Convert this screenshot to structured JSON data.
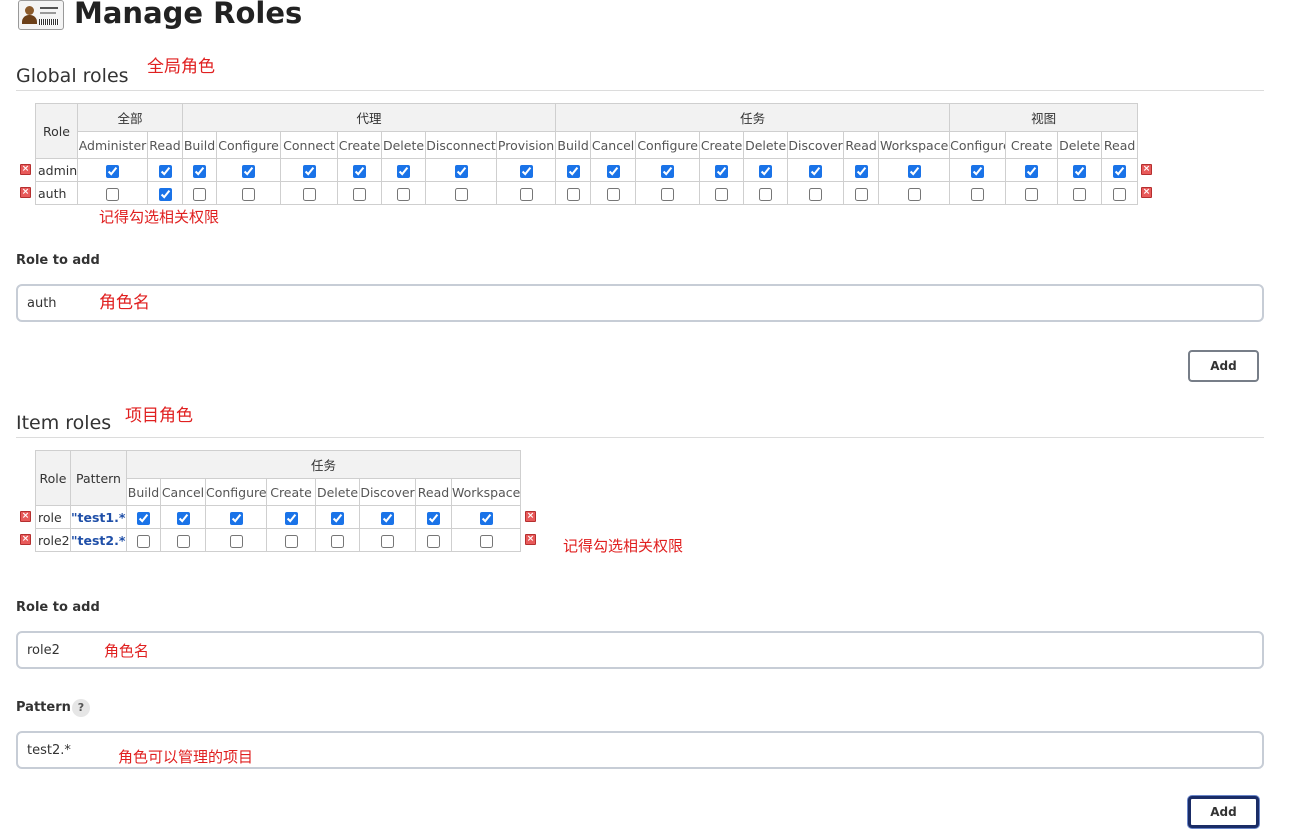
{
  "header": {
    "title": "Manage Roles",
    "icon": "user-card-icon"
  },
  "global_roles": {
    "title": "Global roles",
    "annotation": "全局角色",
    "role_header": "Role",
    "groups": [
      {
        "label": "全部",
        "perms": [
          "Administer",
          "Read"
        ]
      },
      {
        "label": "代理",
        "perms": [
          "Build",
          "Configure",
          "Connect",
          "Create",
          "Delete",
          "Disconnect",
          "Provision"
        ]
      },
      {
        "label": "任务",
        "perms": [
          "Build",
          "Cancel",
          "Configure",
          "Create",
          "Delete",
          "Discover",
          "Read",
          "Workspace"
        ]
      },
      {
        "label": "视图",
        "perms": [
          "Configure",
          "Create",
          "Delete",
          "Read"
        ]
      }
    ],
    "rows": [
      {
        "name": "admin",
        "checks": [
          true,
          true,
          true,
          true,
          true,
          true,
          true,
          true,
          true,
          true,
          true,
          true,
          true,
          true,
          true,
          true,
          true,
          true,
          true,
          true,
          true
        ]
      },
      {
        "name": "auth",
        "checks": [
          false,
          true,
          false,
          false,
          false,
          false,
          false,
          false,
          false,
          false,
          false,
          false,
          false,
          false,
          false,
          false,
          false,
          false,
          false,
          false,
          false
        ]
      }
    ],
    "table_annotation": "记得勾选相关权限",
    "role_to_add_label": "Role to add",
    "role_to_add_value": "auth",
    "role_to_add_annotation": "角色名",
    "add_button": "Add"
  },
  "item_roles": {
    "title": "Item roles",
    "annotation": "项目角色",
    "role_header": "Role",
    "pattern_header": "Pattern",
    "groups": [
      {
        "label": "任务",
        "perms": [
          "Build",
          "Cancel",
          "Configure",
          "Create",
          "Delete",
          "Discover",
          "Read",
          "Workspace"
        ]
      }
    ],
    "rows": [
      {
        "name": "role",
        "pattern": "\"test1.*\"",
        "checks": [
          true,
          true,
          true,
          true,
          true,
          true,
          true,
          true
        ]
      },
      {
        "name": "role2",
        "pattern": "\"test2.*\"",
        "checks": [
          false,
          false,
          false,
          false,
          false,
          false,
          false,
          false
        ]
      }
    ],
    "table_annotation": "记得勾选相关权限",
    "role_to_add_label": "Role to add",
    "role_to_add_value": "role2",
    "role_to_add_annotation": "角色名",
    "pattern_label": "Pattern",
    "pattern_help": "?",
    "pattern_value": "test2.*",
    "pattern_annotation": "角色可以管理的项目",
    "add_button": "Add"
  },
  "colors": {
    "annotation": "#e02020",
    "checkbox": "#1a73e8",
    "pattern_text": "#1f4fa8"
  }
}
